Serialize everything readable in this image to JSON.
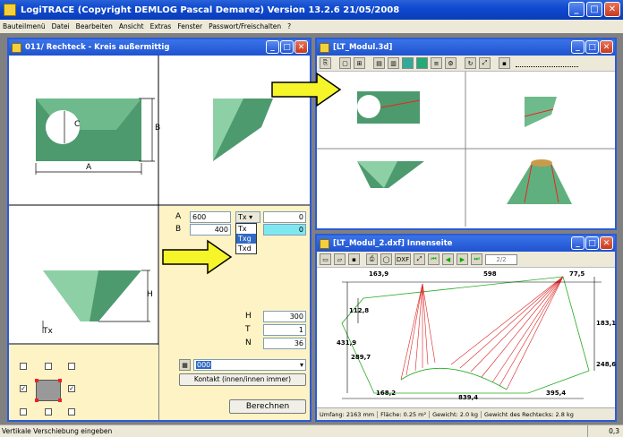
{
  "app": {
    "title": "LogiTRACE  (Copyright DEMLOG Pascal Demarez)  Version 13.2.6  21/05/2008"
  },
  "menu": [
    "Bauteilmenü",
    "Datei",
    "Bearbeiten",
    "Ansicht",
    "Extras",
    "Fenster",
    "Passwort/Freischalten",
    "?"
  ],
  "status": {
    "text": "Vertikale Verschiebung eingeben",
    "right": "0,3"
  },
  "win_main": {
    "title": "011/ Rechteck - Kreis außermittig",
    "labels": {
      "a": "A",
      "b": "B",
      "c": "C",
      "h": "H",
      "tx": "Tx"
    },
    "params": {
      "a_label": "A",
      "a_value": "600",
      "b_label": "B",
      "b_value": "400",
      "tx_select": "Tx ▾",
      "tx_value": "0",
      "second_value": "0"
    },
    "dropdown": [
      "Tx",
      "Txg",
      "Txd"
    ],
    "h_label": "H",
    "h_value": "300",
    "t_label": "T",
    "t_value": "1",
    "n_label": "N",
    "n_value": "36",
    "combo_value": "000",
    "contact_button": "Kontakt (innen/innen immer)",
    "compute_button": "Berechnen"
  },
  "win_3d": {
    "title": "[LT_Modul.3d]"
  },
  "win_dxf": {
    "title": "[LT_Modul_2.dxf]  Innenseite",
    "page": "2/2",
    "dims": {
      "top1": "163,9",
      "top2": "598",
      "top3": "77,5",
      "left1": "112,8",
      "left2": "431,9",
      "left3": "289,7",
      "right1": "183,1",
      "right2": "248,6",
      "bot1": "168,2",
      "bot2": "395,4",
      "bot3": "839,4"
    },
    "status": [
      "Umfang: 2163 mm",
      "Fläche: 0.25 m²",
      "Gewicht: 2.0 kg",
      "Gewicht des Rechtecks: 2.8 kg"
    ]
  },
  "colors": {
    "shape_fill": "#5fa87c",
    "arrow_fill": "#f5f52a",
    "panel_bg": "#fdf3c4"
  }
}
